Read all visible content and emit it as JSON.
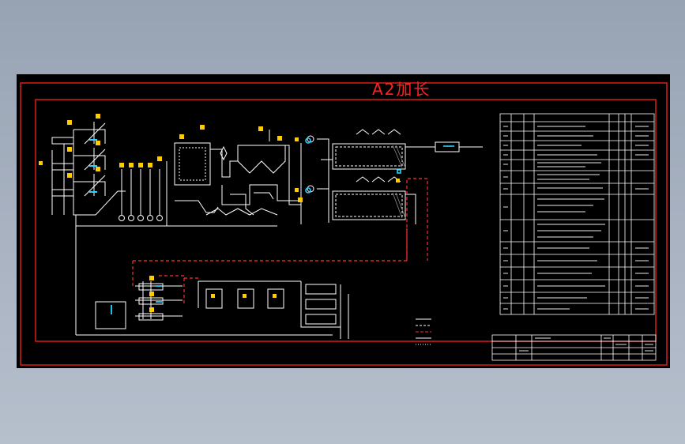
{
  "sheet": {
    "title": "A2加长",
    "colors": {
      "background": "#000000",
      "frame": "#ff2020",
      "lines": "#ffffff",
      "dashed_return": "#ff3030",
      "accent_yellow": "#ffcc00",
      "accent_cyan": "#2ad0ff"
    }
  }
}
